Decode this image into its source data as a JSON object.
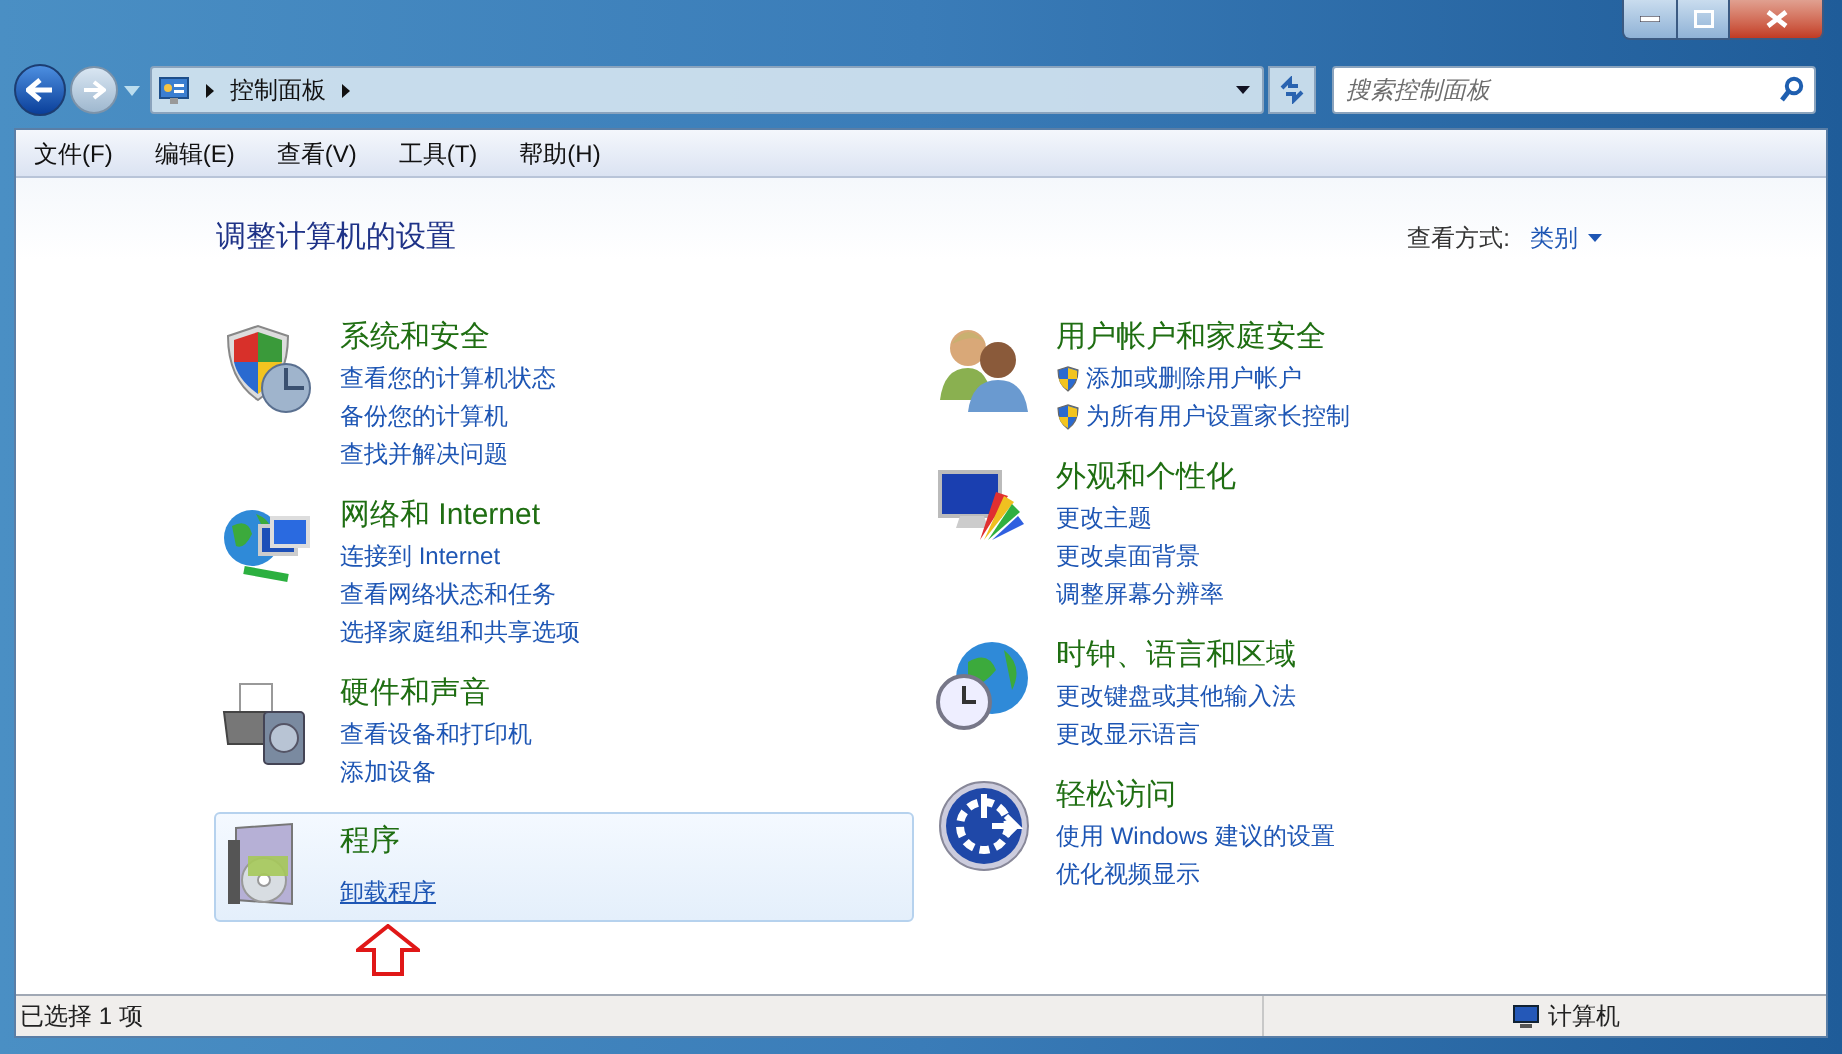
{
  "address_bar": {
    "breadcrumb": [
      "控制面板"
    ]
  },
  "search": {
    "placeholder": "搜索控制面板"
  },
  "menu": [
    "文件(F)",
    "编辑(E)",
    "查看(V)",
    "工具(T)",
    "帮助(H)"
  ],
  "heading": "调整计算机的设置",
  "view_by": {
    "label": "查看方式:",
    "value": "类别"
  },
  "columns": [
    [
      {
        "title": "系统和安全",
        "selected": false,
        "links": [
          {
            "kind": "plain",
            "text": "查看您的计算机状态"
          },
          {
            "kind": "plain",
            "text": "备份您的计算机"
          },
          {
            "kind": "plain",
            "text": "查找并解决问题"
          }
        ]
      },
      {
        "title": "网络和 Internet",
        "selected": false,
        "links": [
          {
            "kind": "plain",
            "text": "连接到 Internet"
          },
          {
            "kind": "plain",
            "text": "查看网络状态和任务"
          },
          {
            "kind": "plain",
            "text": "选择家庭组和共享选项"
          }
        ]
      },
      {
        "title": "硬件和声音",
        "selected": false,
        "links": [
          {
            "kind": "plain",
            "text": "查看设备和打印机"
          },
          {
            "kind": "plain",
            "text": "添加设备"
          }
        ]
      },
      {
        "title": "程序",
        "selected": true,
        "links": [
          {
            "kind": "plain",
            "text": "卸载程序"
          }
        ]
      }
    ],
    [
      {
        "title": "用户帐户和家庭安全",
        "selected": false,
        "links": [
          {
            "kind": "shield",
            "text": "添加或删除用户帐户"
          },
          {
            "kind": "shield",
            "text": "为所有用户设置家长控制"
          }
        ]
      },
      {
        "title": "外观和个性化",
        "selected": false,
        "links": [
          {
            "kind": "plain",
            "text": "更改主题"
          },
          {
            "kind": "plain",
            "text": "更改桌面背景"
          },
          {
            "kind": "plain",
            "text": "调整屏幕分辨率"
          }
        ]
      },
      {
        "title": "时钟、语言和区域",
        "selected": false,
        "links": [
          {
            "kind": "plain",
            "text": "更改键盘或其他输入法"
          },
          {
            "kind": "plain",
            "text": "更改显示语言"
          }
        ]
      },
      {
        "title": "轻松访问",
        "selected": false,
        "links": [
          {
            "kind": "plain",
            "text": "使用 Windows 建议的设置"
          },
          {
            "kind": "plain",
            "text": "优化视频显示"
          }
        ]
      }
    ]
  ],
  "status_bar": {
    "selection": "已选择 1 项",
    "location": "计算机"
  }
}
